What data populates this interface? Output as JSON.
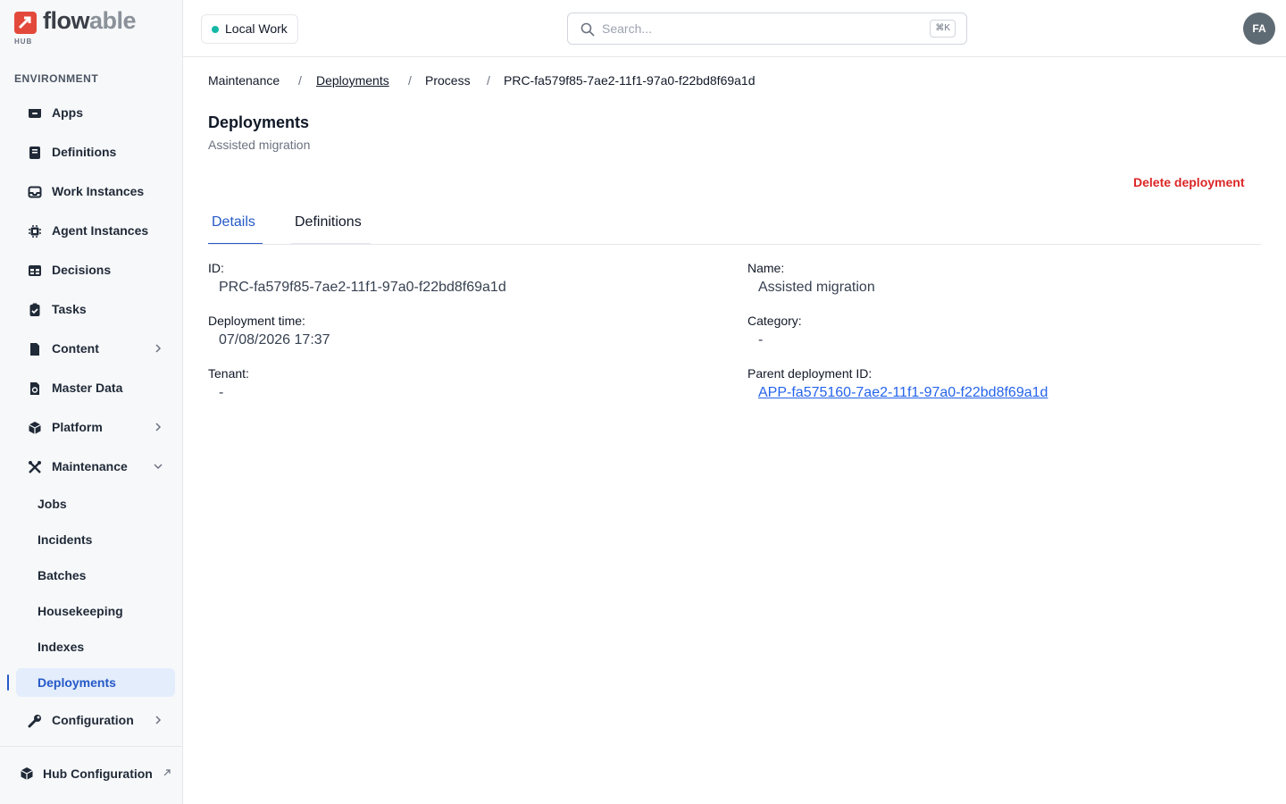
{
  "brand": {
    "name_part1": "flow",
    "name_part2": "able",
    "sub": "HUB"
  },
  "sidebar": {
    "section_label": "ENVIRONMENT",
    "items": [
      {
        "label": "Apps",
        "icon": "box-icon"
      },
      {
        "label": "Definitions",
        "icon": "book-icon"
      },
      {
        "label": "Work Instances",
        "icon": "inbox-icon"
      },
      {
        "label": "Agent Instances",
        "icon": "chip-icon"
      },
      {
        "label": "Decisions",
        "icon": "table-icon"
      },
      {
        "label": "Tasks",
        "icon": "clipboard-check-icon"
      },
      {
        "label": "Content",
        "icon": "document-icon",
        "expandable": true
      },
      {
        "label": "Master Data",
        "icon": "data-file-icon"
      },
      {
        "label": "Platform",
        "icon": "cube-icon",
        "expandable": true
      },
      {
        "label": "Maintenance",
        "icon": "tools-icon",
        "expanded": true
      }
    ],
    "maintenance_children": [
      {
        "label": "Jobs"
      },
      {
        "label": "Incidents"
      },
      {
        "label": "Batches"
      },
      {
        "label": "Housekeeping"
      },
      {
        "label": "Indexes"
      },
      {
        "label": "Deployments",
        "active": true
      }
    ],
    "configuration": {
      "label": "Configuration",
      "icon": "wrench-icon"
    },
    "hub_config": {
      "label": "Hub Configuration",
      "icon": "cube-icon"
    }
  },
  "header": {
    "workspace": "Local Work",
    "search_placeholder": "Search...",
    "search_shortcut": "⌘K",
    "avatar_initials": "FA"
  },
  "breadcrumb": [
    "Maintenance",
    "Deployments",
    "Process",
    "PRC-fa579f85-7ae2-11f1-97a0-f22bd8f69a1d"
  ],
  "page": {
    "title": "Deployments",
    "subtitle": "Assisted migration",
    "delete_label": "Delete deployment",
    "tabs": [
      "Details",
      "Definitions"
    ]
  },
  "details": {
    "id_label": "ID:",
    "id_value": "PRC-fa579f85-7ae2-11f1-97a0-f22bd8f69a1d",
    "name_label": "Name:",
    "name_value": "Assisted migration",
    "deploy_time_label": "Deployment time:",
    "deploy_time_value": "07/08/2026 17:37",
    "category_label": "Category:",
    "category_value": "-",
    "tenant_label": "Tenant:",
    "tenant_value": "-",
    "parent_label": "Parent deployment ID:",
    "parent_value": "APP-fa575160-7ae2-11f1-97a0-f22bd8f69a1d"
  },
  "colors": {
    "accent": "#2559c7",
    "danger": "#dc2626",
    "status_dot": "#14b8a6",
    "brand_red": "#e3493b"
  }
}
